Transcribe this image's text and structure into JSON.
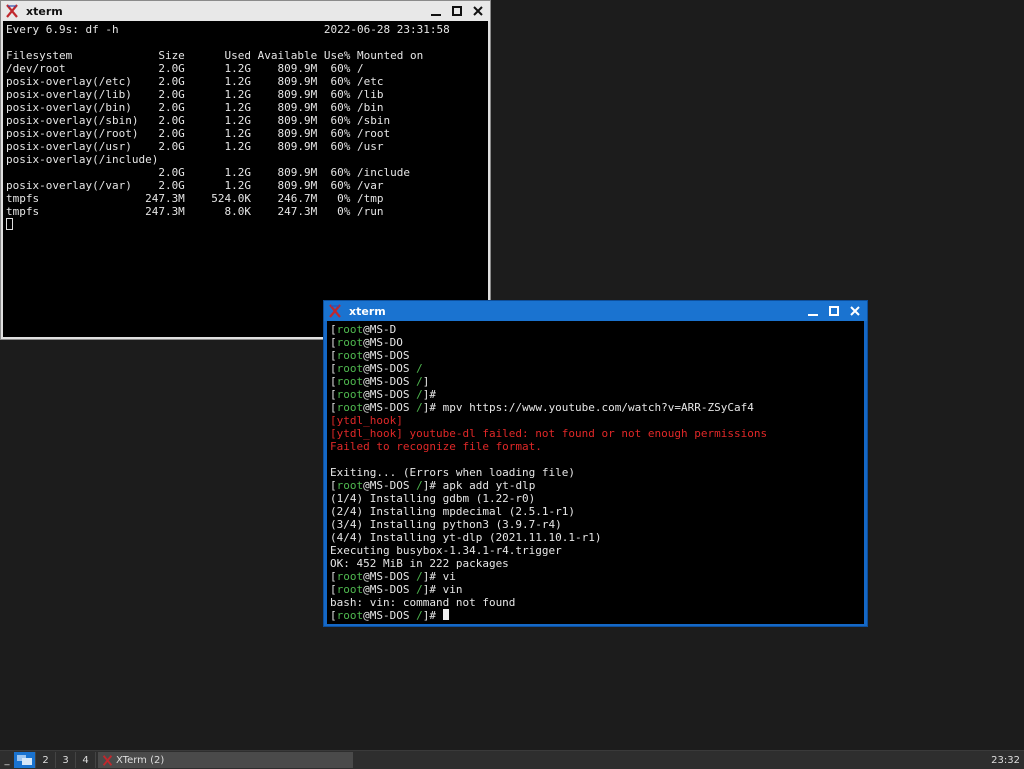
{
  "win1": {
    "title": "xterm",
    "lines": [
      {
        "segs": [
          {
            "t": "Every 6.9s: df -h                               2022-06-28 23:31:58"
          }
        ]
      },
      {
        "segs": [
          {
            "t": ""
          }
        ]
      },
      {
        "segs": [
          {
            "t": "Filesystem             Size      Used Available Use% Mounted on"
          }
        ]
      },
      {
        "segs": [
          {
            "t": "/dev/root              2.0G      1.2G    809.9M  60% /"
          }
        ]
      },
      {
        "segs": [
          {
            "t": "posix-overlay(/etc)    2.0G      1.2G    809.9M  60% /etc"
          }
        ]
      },
      {
        "segs": [
          {
            "t": "posix-overlay(/lib)    2.0G      1.2G    809.9M  60% /lib"
          }
        ]
      },
      {
        "segs": [
          {
            "t": "posix-overlay(/bin)    2.0G      1.2G    809.9M  60% /bin"
          }
        ]
      },
      {
        "segs": [
          {
            "t": "posix-overlay(/sbin)   2.0G      1.2G    809.9M  60% /sbin"
          }
        ]
      },
      {
        "segs": [
          {
            "t": "posix-overlay(/root)   2.0G      1.2G    809.9M  60% /root"
          }
        ]
      },
      {
        "segs": [
          {
            "t": "posix-overlay(/usr)    2.0G      1.2G    809.9M  60% /usr"
          }
        ]
      },
      {
        "segs": [
          {
            "t": "posix-overlay(/include)"
          }
        ]
      },
      {
        "segs": [
          {
            "t": "                       2.0G      1.2G    809.9M  60% /include"
          }
        ]
      },
      {
        "segs": [
          {
            "t": "posix-overlay(/var)    2.0G      1.2G    809.9M  60% /var"
          }
        ]
      },
      {
        "segs": [
          {
            "t": "tmpfs                247.3M    524.0K    246.7M   0% /tmp"
          }
        ]
      },
      {
        "segs": [
          {
            "t": "tmpfs                247.3M      8.0K    247.3M   0% /run"
          }
        ]
      }
    ]
  },
  "win2": {
    "title": "xterm",
    "lines": [
      {
        "segs": [
          {
            "t": "["
          },
          {
            "t": "root",
            "c": "g"
          },
          {
            "t": "@MS-D"
          }
        ]
      },
      {
        "segs": [
          {
            "t": "["
          },
          {
            "t": "root",
            "c": "g"
          },
          {
            "t": "@MS-DO"
          }
        ]
      },
      {
        "segs": [
          {
            "t": "["
          },
          {
            "t": "root",
            "c": "g"
          },
          {
            "t": "@MS-DOS"
          }
        ]
      },
      {
        "segs": [
          {
            "t": "["
          },
          {
            "t": "root",
            "c": "g"
          },
          {
            "t": "@MS-DOS "
          },
          {
            "t": "/",
            "c": "g"
          }
        ]
      },
      {
        "segs": [
          {
            "t": "["
          },
          {
            "t": "root",
            "c": "g"
          },
          {
            "t": "@MS-DOS "
          },
          {
            "t": "/",
            "c": "g"
          },
          {
            "t": "]"
          }
        ]
      },
      {
        "segs": [
          {
            "t": "["
          },
          {
            "t": "root",
            "c": "g"
          },
          {
            "t": "@MS-DOS "
          },
          {
            "t": "/",
            "c": "g"
          },
          {
            "t": "]#"
          }
        ]
      },
      {
        "segs": [
          {
            "t": "["
          },
          {
            "t": "root",
            "c": "g"
          },
          {
            "t": "@MS-DOS "
          },
          {
            "t": "/",
            "c": "g"
          },
          {
            "t": "]# mpv https://www.youtube.com/watch?v=ARR-ZSyCaf4"
          }
        ]
      },
      {
        "segs": [
          {
            "t": "[ytdl_hook]",
            "c": "r"
          }
        ]
      },
      {
        "segs": [
          {
            "t": "[ytdl_hook] youtube-dl failed: not found or not enough permissions",
            "c": "r"
          }
        ]
      },
      {
        "segs": [
          {
            "t": "Failed to recognize file format.",
            "c": "r"
          }
        ]
      },
      {
        "segs": [
          {
            "t": ""
          }
        ]
      },
      {
        "segs": [
          {
            "t": "Exiting... (Errors when loading file)"
          }
        ]
      },
      {
        "segs": [
          {
            "t": "["
          },
          {
            "t": "root",
            "c": "g"
          },
          {
            "t": "@MS-DOS "
          },
          {
            "t": "/",
            "c": "g"
          },
          {
            "t": "]# apk add yt-dlp"
          }
        ]
      },
      {
        "segs": [
          {
            "t": "(1/4) Installing gdbm (1.22-r0)"
          }
        ]
      },
      {
        "segs": [
          {
            "t": "(2/4) Installing mpdecimal (2.5.1-r1)"
          }
        ]
      },
      {
        "segs": [
          {
            "t": "(3/4) Installing python3 (3.9.7-r4)"
          }
        ]
      },
      {
        "segs": [
          {
            "t": "(4/4) Installing yt-dlp (2021.11.10.1-r1)"
          }
        ]
      },
      {
        "segs": [
          {
            "t": "Executing busybox-1.34.1-r4.trigger"
          }
        ]
      },
      {
        "segs": [
          {
            "t": "OK: 452 MiB in 222 packages"
          }
        ]
      },
      {
        "segs": [
          {
            "t": "["
          },
          {
            "t": "root",
            "c": "g"
          },
          {
            "t": "@MS-DOS "
          },
          {
            "t": "/",
            "c": "g"
          },
          {
            "t": "]# vi"
          }
        ]
      },
      {
        "segs": [
          {
            "t": "["
          },
          {
            "t": "root",
            "c": "g"
          },
          {
            "t": "@MS-DOS "
          },
          {
            "t": "/",
            "c": "g"
          },
          {
            "t": "]# vin"
          }
        ]
      },
      {
        "segs": [
          {
            "t": "bash: vin: command not found"
          }
        ]
      },
      {
        "segs": [
          {
            "t": "["
          },
          {
            "t": "root",
            "c": "g"
          },
          {
            "t": "@MS-DOS "
          },
          {
            "t": "/",
            "c": "g"
          },
          {
            "t": "]# "
          }
        ],
        "cursor": true
      }
    ]
  },
  "taskbar": {
    "menu_label": "_",
    "workspaces": [
      "1",
      "2",
      "3",
      "4"
    ],
    "active_workspace": "1",
    "task_label": "XTerm (2)",
    "clock": "23:32"
  },
  "colors": {
    "active_title": "#1a73d0",
    "prompt_green": "#4fb84f",
    "error_red": "#e02828"
  }
}
